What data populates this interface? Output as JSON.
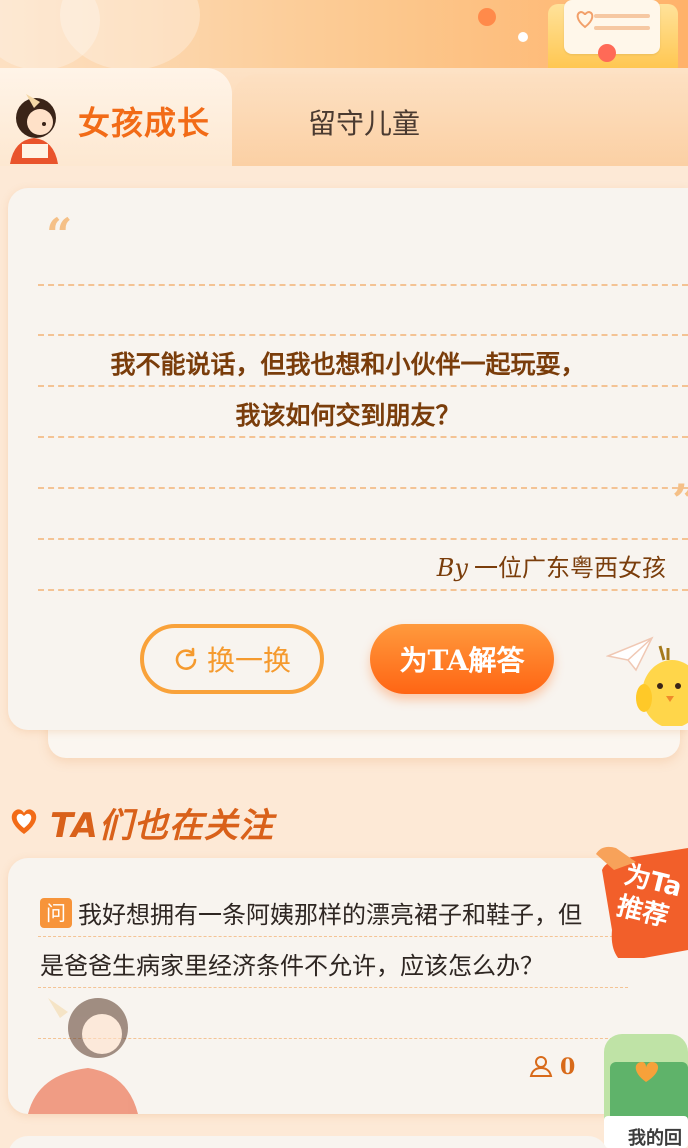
{
  "tabs": [
    {
      "label": "女孩成长",
      "active": true
    },
    {
      "label": "留守儿童",
      "active": false
    }
  ],
  "question": {
    "line1": "我不能说话，但我也想和小伙伴一起玩耍，",
    "line2": "我该如何交到朋友？",
    "by_prefix": "By",
    "author": "一位广东粤西女孩",
    "quote_open": "“",
    "quote_close": "”"
  },
  "buttons": {
    "refresh_label": "换一换",
    "answer_label": "为TA解答"
  },
  "section": {
    "title": "TA们也在关注"
  },
  "related": [
    {
      "badge": "问",
      "text": "我好想拥有一条阿姨那样的漂亮裙子和鞋子，但是爸爸生病家里经济条件不允许，应该怎么办？",
      "likes": "0"
    }
  ],
  "ribbon": {
    "label": "为Ta推荐"
  },
  "my_answer": {
    "label": "我的回"
  },
  "colors": {
    "accent": "#f26b17",
    "button_gradient_top": "#ff9a3d",
    "button_gradient_bottom": "#ff6514",
    "question_text": "#7a3d0b",
    "dash_line": "#f4c394"
  },
  "icons": [
    "refresh-icon",
    "heart-icon",
    "person-icon",
    "envelope-icon",
    "paper-plane-icon"
  ]
}
